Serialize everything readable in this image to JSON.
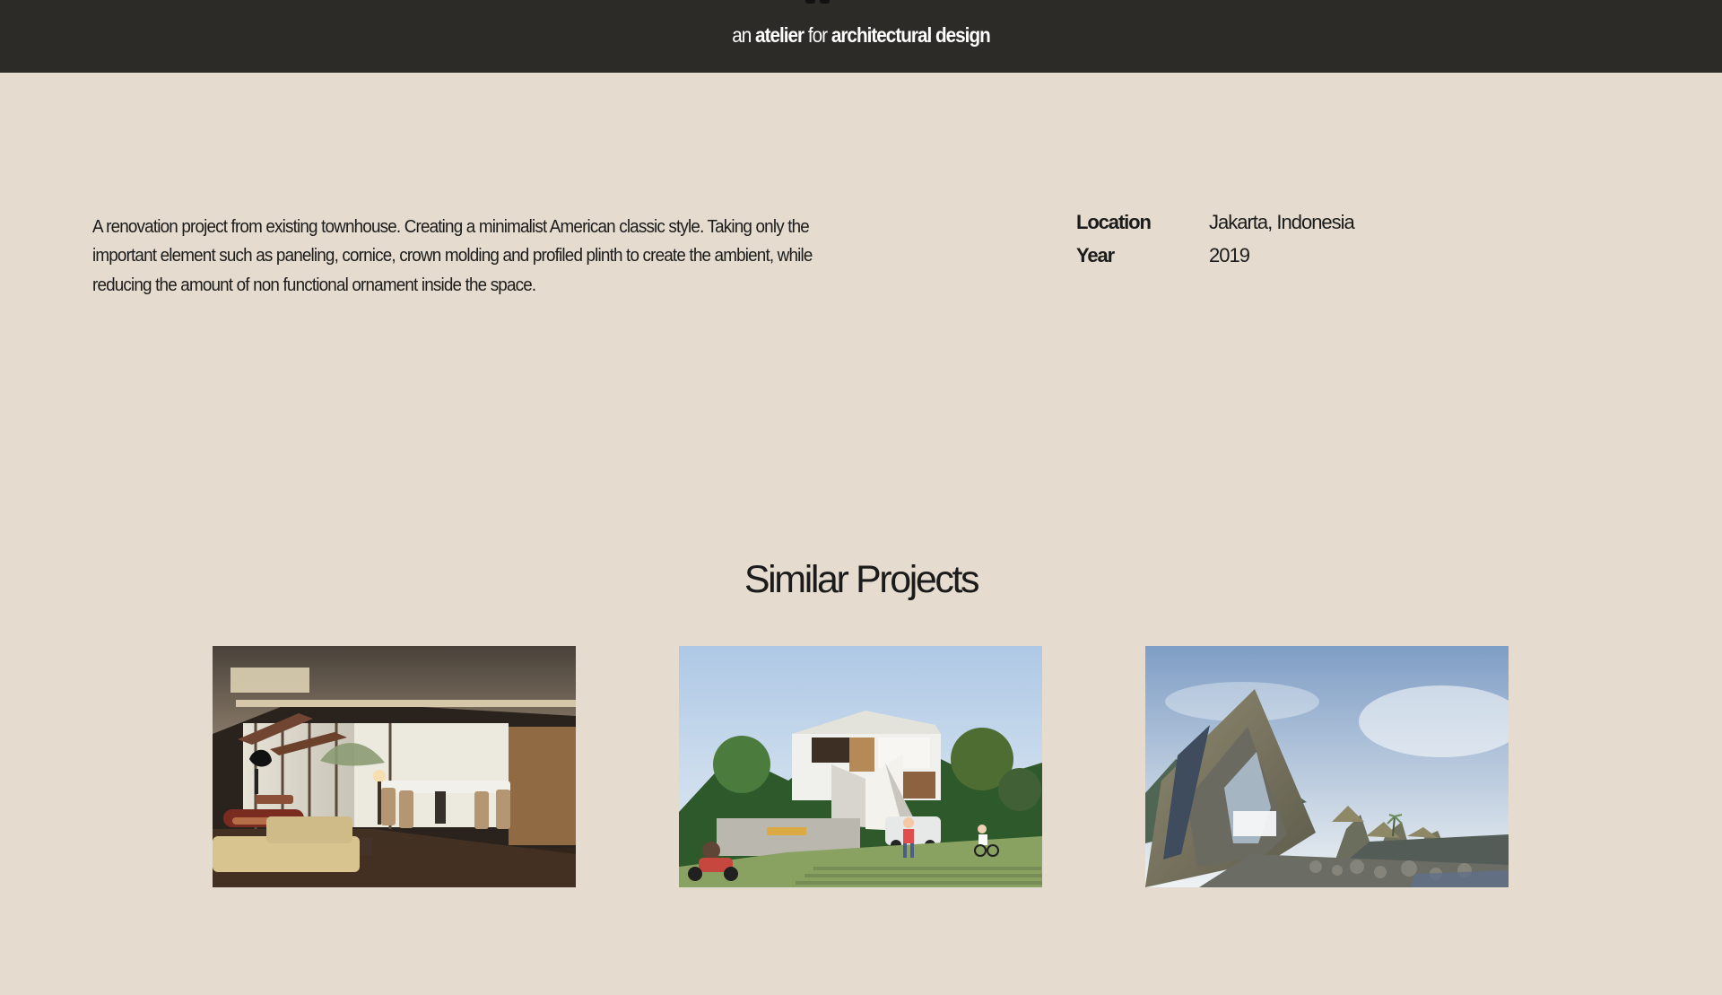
{
  "header": {
    "tagline": {
      "part1": "an",
      "part2": "atelier",
      "part3": "for",
      "part4": "architectural design"
    }
  },
  "project": {
    "description": "A renovation project from existing townhouse. Creating a minimalist American classic style. Taking only the important element such as paneling, cornice, crown molding and profiled plinth to create the ambient, while reducing the amount of non functional ornament inside the space.",
    "details": [
      {
        "label": "Location",
        "value": "Jakarta, Indonesia"
      },
      {
        "label": "Year",
        "value": "2019"
      }
    ]
  },
  "similar_projects": {
    "title": "Similar Projects",
    "cards": [
      {
        "image": "interior-living-dining-image"
      },
      {
        "image": "modern-house-exterior-image"
      },
      {
        "image": "thatched-a-frame-villas-image"
      }
    ]
  }
}
